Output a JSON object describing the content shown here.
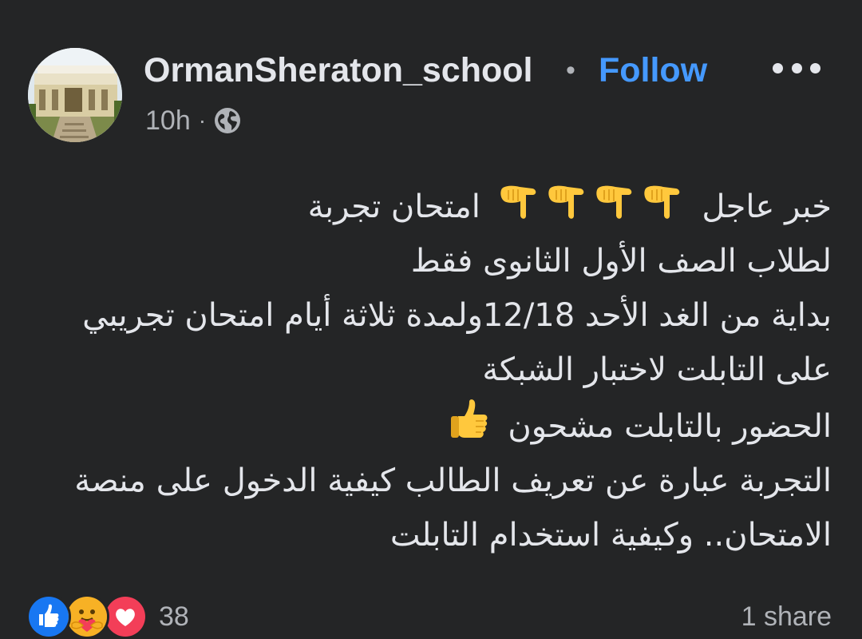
{
  "header": {
    "page_name": "OrmanSheraton_school",
    "separator": "•",
    "follow_label": "Follow",
    "time": "10h",
    "meta_separator": "·",
    "audience_icon": "globe-icon"
  },
  "post": {
    "lines": [
      {
        "before": "خبر عاجل",
        "emojis": [
          "backhand-index-pointing-down",
          "backhand-index-pointing-down",
          "backhand-index-pointing-down",
          "backhand-index-pointing-down"
        ],
        "after": "امتحان تجربة"
      },
      {
        "text": "لطلاب الصف الأول الثانوى فقط"
      },
      {
        "text": "بداية من الغد الأحد 12/18ولمدة ثلاثة أيام امتحان تجريبي"
      },
      {
        "text": "على التابلت لاختبار الشبكة"
      },
      {
        "before": "الحضور بالتابلت مشحون",
        "emojis": [
          "thumbs-up"
        ]
      },
      {
        "text": "التجربة عبارة عن تعريف الطالب كيفية الدخول على منصة"
      },
      {
        "text": "الامتحان.. وكيفية استخدام التابلت"
      }
    ]
  },
  "footer": {
    "reactions": [
      "like-reaction-icon",
      "care-reaction-icon",
      "love-reaction-icon"
    ],
    "reaction_count": "38",
    "shares": "1 share"
  },
  "colors": {
    "background": "#242526",
    "text": "#e4e6eb",
    "secondary": "#b0b3b8",
    "link": "#4599ff",
    "like": "#1877f2",
    "love": "#f33e58"
  }
}
